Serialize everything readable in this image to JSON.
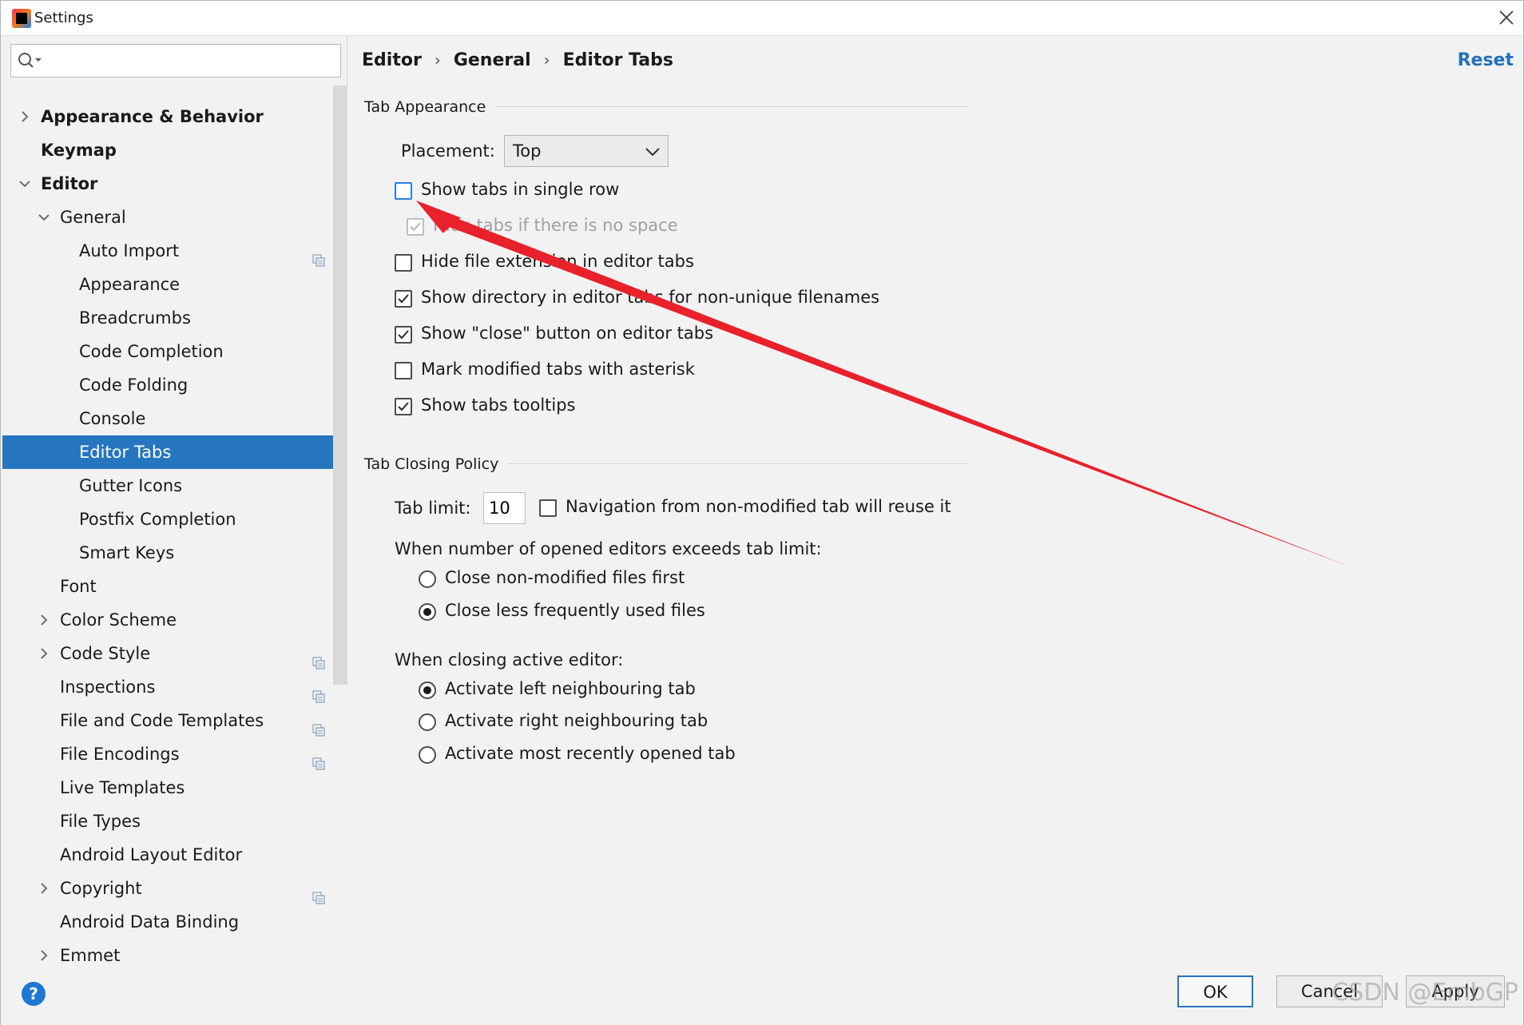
{
  "window": {
    "title": "Settings"
  },
  "search": {
    "placeholder": ""
  },
  "tree": [
    {
      "label": "Appearance & Behavior",
      "bold": true,
      "level": 0,
      "chevron": "right"
    },
    {
      "label": "Keymap",
      "bold": true,
      "level": 0,
      "chevron": "none"
    },
    {
      "label": "Editor",
      "bold": true,
      "level": 0,
      "chevron": "down"
    },
    {
      "label": "General",
      "bold": false,
      "level": 1,
      "chevron": "down"
    },
    {
      "label": "Auto Import",
      "bold": false,
      "level": 2,
      "chevron": "none",
      "project": true
    },
    {
      "label": "Appearance",
      "bold": false,
      "level": 2,
      "chevron": "none"
    },
    {
      "label": "Breadcrumbs",
      "bold": false,
      "level": 2,
      "chevron": "none"
    },
    {
      "label": "Code Completion",
      "bold": false,
      "level": 2,
      "chevron": "none"
    },
    {
      "label": "Code Folding",
      "bold": false,
      "level": 2,
      "chevron": "none"
    },
    {
      "label": "Console",
      "bold": false,
      "level": 2,
      "chevron": "none"
    },
    {
      "label": "Editor Tabs",
      "bold": false,
      "level": 2,
      "chevron": "none",
      "selected": true
    },
    {
      "label": "Gutter Icons",
      "bold": false,
      "level": 2,
      "chevron": "none"
    },
    {
      "label": "Postfix Completion",
      "bold": false,
      "level": 2,
      "chevron": "none"
    },
    {
      "label": "Smart Keys",
      "bold": false,
      "level": 2,
      "chevron": "none"
    },
    {
      "label": "Font",
      "bold": false,
      "level": 1,
      "chevron": "none"
    },
    {
      "label": "Color Scheme",
      "bold": false,
      "level": 1,
      "chevron": "right"
    },
    {
      "label": "Code Style",
      "bold": false,
      "level": 1,
      "chevron": "right",
      "project": true
    },
    {
      "label": "Inspections",
      "bold": false,
      "level": 1,
      "chevron": "none",
      "project": true
    },
    {
      "label": "File and Code Templates",
      "bold": false,
      "level": 1,
      "chevron": "none",
      "project": true
    },
    {
      "label": "File Encodings",
      "bold": false,
      "level": 1,
      "chevron": "none",
      "project": true
    },
    {
      "label": "Live Templates",
      "bold": false,
      "level": 1,
      "chevron": "none"
    },
    {
      "label": "File Types",
      "bold": false,
      "level": 1,
      "chevron": "none"
    },
    {
      "label": "Android Layout Editor",
      "bold": false,
      "level": 1,
      "chevron": "none"
    },
    {
      "label": "Copyright",
      "bold": false,
      "level": 1,
      "chevron": "right",
      "project": true
    },
    {
      "label": "Android Data Binding",
      "bold": false,
      "level": 1,
      "chevron": "none"
    },
    {
      "label": "Emmet",
      "bold": false,
      "level": 1,
      "chevron": "right"
    }
  ],
  "breadcrumb": {
    "item1": "Editor",
    "item2": "General",
    "item3": "Editor Tabs",
    "separator": "›"
  },
  "reset_label": "Reset",
  "tab_appearance": {
    "title": "Tab Appearance",
    "placement_label": "Placement:",
    "placement_value": "Top",
    "options": {
      "single_row": {
        "label": "Show tabs in single row",
        "checked": false
      },
      "hide_no_space": {
        "label": "Hide tabs if there is no space",
        "checked": true,
        "disabled": true
      },
      "hide_ext": {
        "label": "Hide file extension in editor tabs",
        "checked": false
      },
      "show_dir": {
        "label": "Show directory in editor tabs for non-unique filenames",
        "checked": true
      },
      "show_close": {
        "label": "Show \"close\" button on editor tabs",
        "checked": true
      },
      "mark_modified": {
        "label": "Mark modified tabs with asterisk",
        "checked": false
      },
      "tooltips": {
        "label": "Show tabs tooltips",
        "checked": true
      }
    }
  },
  "tab_closing": {
    "title": "Tab Closing Policy",
    "tab_limit_label": "Tab limit:",
    "tab_limit_value": "10",
    "navigation_label": "Navigation from non-modified tab will reuse it",
    "navigation_checked": false,
    "exceeds_label": "When number of opened editors exceeds tab limit:",
    "close_nonmodified": "Close non-modified files first",
    "close_less_frequent": "Close less frequently used files",
    "exceeds_selected": "close_less_frequent",
    "active_label": "When closing active editor:",
    "activate_left": "Activate left neighbouring tab",
    "activate_right": "Activate right neighbouring tab",
    "activate_recent": "Activate most recently opened tab",
    "active_selected": "activate_left"
  },
  "buttons": {
    "help": "?",
    "ok": "OK",
    "cancel": "Cancel",
    "apply": "Apply"
  },
  "watermark": "CSDN @EmbGP",
  "colors": {
    "selection": "#2675bf",
    "link": "#2470b8",
    "annotation_arrow": "#e8212b"
  }
}
